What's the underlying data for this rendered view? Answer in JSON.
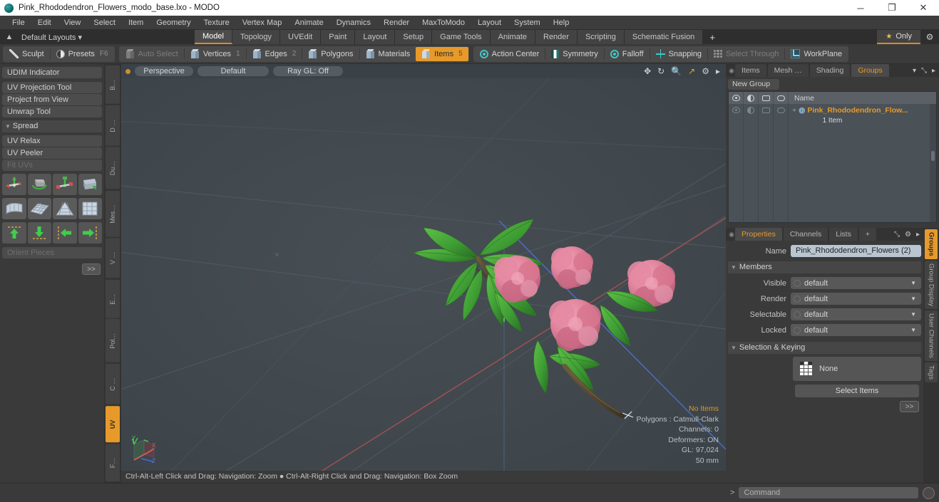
{
  "window": {
    "title": "Pink_Rhododendron_Flowers_modo_base.lxo - MODO",
    "minimize": "─",
    "maximize": "❐",
    "close": "✕"
  },
  "menubar": {
    "items": [
      "File",
      "Edit",
      "View",
      "Select",
      "Item",
      "Geometry",
      "Texture",
      "Vertex Map",
      "Animate",
      "Dynamics",
      "Render",
      "MaxToModo",
      "Layout",
      "System",
      "Help"
    ]
  },
  "layoutbar": {
    "home_icon": "▲",
    "default_layouts": "Default Layouts ▾",
    "tabs": [
      {
        "label": "Model",
        "active": true
      },
      {
        "label": "Topology",
        "active": false
      },
      {
        "label": "UVEdit",
        "active": false
      },
      {
        "label": "Paint",
        "active": false
      },
      {
        "label": "Layout",
        "active": false
      },
      {
        "label": "Setup",
        "active": false
      },
      {
        "label": "Game Tools",
        "active": false
      },
      {
        "label": "Animate",
        "active": false
      },
      {
        "label": "Render",
        "active": false
      },
      {
        "label": "Scripting",
        "active": false
      },
      {
        "label": "Schematic Fusion",
        "active": false
      }
    ],
    "add_tab": "+",
    "only_label": "Only",
    "star": "★",
    "gear": "⚙"
  },
  "toolbar": {
    "left_group": [
      {
        "label": "Sculpt",
        "icon": "brush-icon",
        "state": "normal",
        "badge": ""
      },
      {
        "label": "Presets",
        "icon": "presets-icon",
        "state": "normal",
        "badge": "F6"
      }
    ],
    "select_group": [
      {
        "label": "Auto Select",
        "icon": "cube-icon",
        "state": "dim",
        "badge": ""
      },
      {
        "label": "Vertices",
        "icon": "cube-icon",
        "state": "normal",
        "badge": "1"
      },
      {
        "label": "Edges",
        "icon": "cube-icon",
        "state": "normal",
        "badge": "2"
      },
      {
        "label": "Polygons",
        "icon": "cube-icon",
        "state": "normal",
        "badge": ""
      },
      {
        "label": "Materials",
        "icon": "cube-icon",
        "state": "normal",
        "badge": ""
      },
      {
        "label": "Items",
        "icon": "cube-icon",
        "state": "active",
        "badge": "5"
      }
    ],
    "right_group": [
      {
        "label": "Action Center",
        "icon": "action-center-icon",
        "state": "normal"
      },
      {
        "label": "Symmetry",
        "icon": "symmetry-icon",
        "state": "normal"
      },
      {
        "label": "Falloff",
        "icon": "falloff-icon",
        "state": "normal"
      },
      {
        "label": "Snapping",
        "icon": "snapping-icon",
        "state": "normal"
      },
      {
        "label": "Select Through",
        "icon": "select-through-icon",
        "state": "dim"
      },
      {
        "label": "WorkPlane",
        "icon": "workplane-icon",
        "state": "normal"
      }
    ]
  },
  "left_panel": {
    "buttons": [
      {
        "label": "UDIM Indicator",
        "dim": false,
        "gap": false
      },
      {
        "label": "UV Projection Tool",
        "dim": false,
        "gap": true
      },
      {
        "label": "Project from View",
        "dim": false,
        "gap": false
      },
      {
        "label": "Unwrap Tool",
        "dim": false,
        "gap": false
      }
    ],
    "section": "Spread",
    "buttons2": [
      {
        "label": "UV Relax",
        "dim": false
      },
      {
        "label": "UV Peeler",
        "dim": false
      },
      {
        "label": "Fit UVs",
        "dim": true
      }
    ],
    "orient_pieces": "Orient Pieces",
    "more": ">>",
    "tabs": [
      {
        "label": "B…",
        "active": false
      },
      {
        "label": "D …",
        "active": false
      },
      {
        "label": "Du…",
        "active": false
      },
      {
        "label": "Mes…",
        "active": false
      },
      {
        "label": "V …",
        "active": false
      },
      {
        "label": "E…",
        "active": false
      },
      {
        "label": "Pol…",
        "active": false
      },
      {
        "label": "C …",
        "active": false
      },
      {
        "label": "UV",
        "active": true
      },
      {
        "label": "F…",
        "active": false
      }
    ]
  },
  "viewport": {
    "view_mode": "Perspective",
    "shading": "Default",
    "raygl": "Ray GL: Off",
    "icons": [
      "move-icon",
      "rotate-icon",
      "zoom-icon",
      "fit-icon",
      "gear-icon",
      "arrow-right-icon"
    ],
    "status": {
      "items": "No Items",
      "polygons": "Polygons : Catmull-Clark",
      "channels": "Channels: 0",
      "deformers": "Deformers: ON",
      "gl": "GL: 97,024",
      "scale": "50 mm"
    },
    "footer": "Ctrl-Alt-Left Click and Drag: Navigation: Zoom ●  Ctrl-Alt-Right Click and Drag: Navigation: Box Zoom"
  },
  "right_panel": {
    "tabs": [
      {
        "label": "Items",
        "active": false
      },
      {
        "label": "Mesh …",
        "active": false
      },
      {
        "label": "Shading",
        "active": false
      },
      {
        "label": "Groups",
        "active": true
      }
    ],
    "tab_menu": "▾",
    "expand_icon": "⤡",
    "arrow_icon": "▸",
    "new_group": "New Group",
    "tree": {
      "name_header": "Name",
      "item_name": "Pink_Rhododendron_Flow...",
      "item_count": "1 Item",
      "expander": "+"
    }
  },
  "properties": {
    "tabs": [
      {
        "label": "Properties",
        "active": true
      },
      {
        "label": "Channels",
        "active": false
      },
      {
        "label": "Lists",
        "active": false
      },
      {
        "label": "+",
        "active": false
      }
    ],
    "expand_icon": "⤡",
    "gear_icon": "⚙",
    "arrow_icon": "▸",
    "name_label": "Name",
    "name_value": "Pink_Rhododendron_Flowers (2)",
    "members_section": "Members",
    "rows": [
      {
        "label": "Visible",
        "value": "default"
      },
      {
        "label": "Render",
        "value": "default"
      },
      {
        "label": "Selectable",
        "value": "default"
      },
      {
        "label": "Locked",
        "value": "default"
      }
    ],
    "selection_section": "Selection & Keying",
    "none_value": "None",
    "select_items": "Select Items",
    "more": ">>",
    "side_tabs": [
      {
        "label": "Groups",
        "active": true
      },
      {
        "label": "Group Display",
        "active": false
      },
      {
        "label": "User Channels",
        "active": false
      },
      {
        "label": "Tags",
        "active": false
      }
    ]
  },
  "command_bar": {
    "prompt": ">",
    "placeholder": "Command",
    "record_icon": "record-icon"
  },
  "colors": {
    "accent": "#e79a2a",
    "viewport_bg": "#41484d",
    "panel_bg": "#3a3a3a",
    "field_bg": "#b9c6d2"
  }
}
